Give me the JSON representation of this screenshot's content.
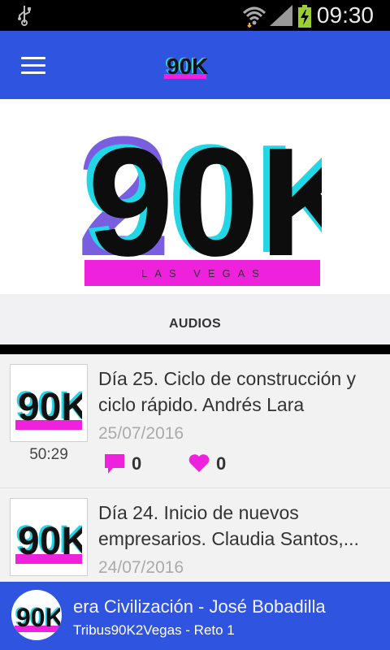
{
  "status_bar": {
    "time": "09:30",
    "icons": [
      "usb-icon",
      "wifi-icon",
      "signal-icon",
      "battery-charging-icon"
    ]
  },
  "app_bar": {
    "menu_icon": "hamburger-menu-icon",
    "logo_text": "90K"
  },
  "hero": {
    "logo_main": "90K",
    "logo_sub": "LAS VEGAS",
    "logo_number": "2"
  },
  "section": {
    "title": "AUDIOS"
  },
  "items": [
    {
      "title": "Día 25. Ciclo de construcción y ciclo rápido. Andrés Lara",
      "date": "25/07/2016",
      "duration": "50:29",
      "comments": "0",
      "likes": "0",
      "thumb_text": "90K"
    },
    {
      "title": "Día 24. Inicio de nuevos empresarios. Claudia Santos,...",
      "date": "24/07/2016",
      "duration": "",
      "comments": "",
      "likes": "",
      "thumb_text": "90K"
    }
  ],
  "player": {
    "title": "era Civilización - José Bobadilla",
    "subtitle": "Tribus90K2Vegas - Reto 1",
    "art_text": "90K"
  },
  "colors": {
    "app_bar": "#2f55e0",
    "accent_magenta": "#ee22dd",
    "logo_cyan": "#22d6e6",
    "status_bar": "#000000"
  }
}
